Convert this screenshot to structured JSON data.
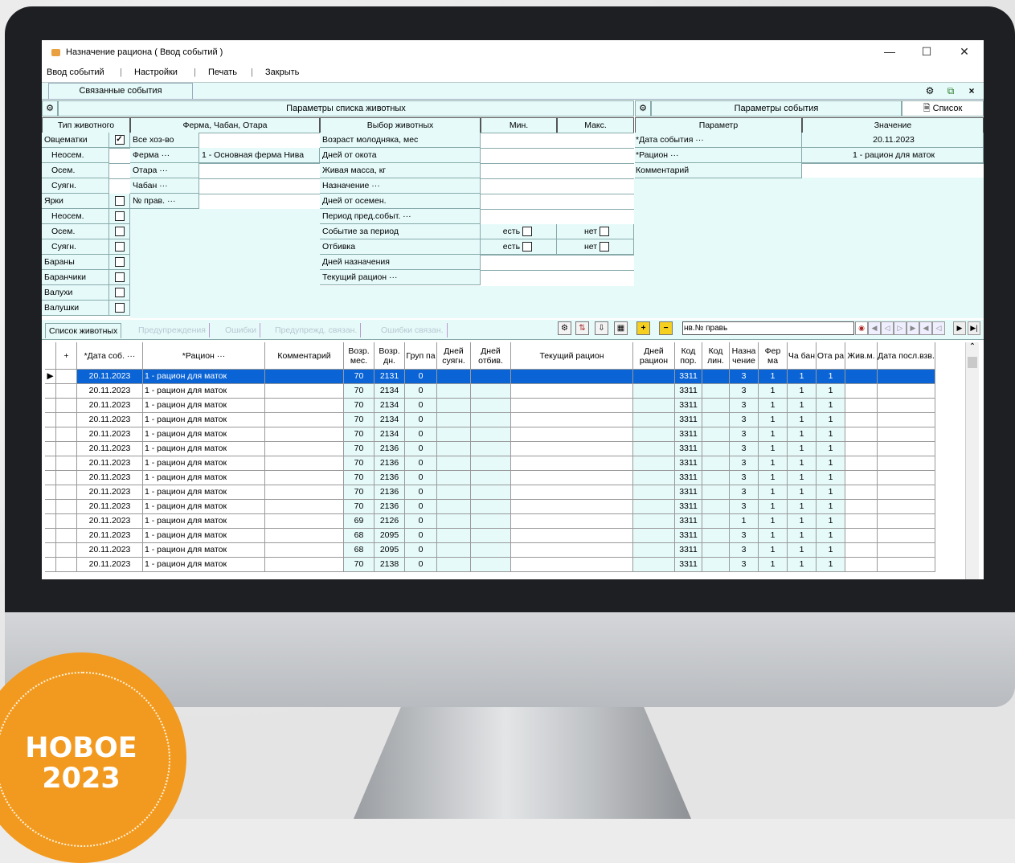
{
  "window": {
    "title": "Назначение рациона ( Ввод событий )"
  },
  "menu": [
    "Ввод событий",
    "Настройки",
    "Печать",
    "Закрыть"
  ],
  "linked_tab": "Связанные события",
  "animal_params": {
    "title": "Параметры списка животных",
    "type_header": "Тип животного",
    "farm_header": "Ферма, Чабан, Отара",
    "select_header": "Выбор животных",
    "min_header": "Мин.",
    "max_header": "Макс.",
    "types": [
      {
        "label": "Овцематки",
        "checked": true,
        "indent": false
      },
      {
        "label": "Неосем.",
        "checked": null,
        "indent": true
      },
      {
        "label": "Осем.",
        "checked": null,
        "indent": true
      },
      {
        "label": "Суягн.",
        "checked": null,
        "indent": true
      },
      {
        "label": "Ярки",
        "checked": false,
        "indent": false
      },
      {
        "label": "Неосем.",
        "checked": false,
        "indent": true
      },
      {
        "label": "Осем.",
        "checked": false,
        "indent": true
      },
      {
        "label": "Суягн.",
        "checked": false,
        "indent": true
      },
      {
        "label": "Бараны",
        "checked": false,
        "indent": false
      },
      {
        "label": "Баранчики",
        "checked": false,
        "indent": false
      },
      {
        "label": "Валухи",
        "checked": false,
        "indent": false
      },
      {
        "label": "Валушки",
        "checked": false,
        "indent": false
      }
    ],
    "farm_rows": [
      {
        "label": "Все хоз-во",
        "value": ""
      },
      {
        "label": "Ферма ···",
        "value": "1 - Основная ферма Нива"
      },
      {
        "label": "Отара ···",
        "value": ""
      },
      {
        "label": "Чабан ···",
        "value": ""
      },
      {
        "label": "№ прав. ···",
        "value": ""
      }
    ],
    "select_rows": [
      {
        "label": "Возраст молодняка, мес",
        "min": "",
        "max": ""
      },
      {
        "label": "Дней от окота",
        "min": "",
        "max": ""
      },
      {
        "label": "Живая масса, кг",
        "min": "",
        "max": ""
      },
      {
        "label": "Назначение ···",
        "min": "",
        "max": ""
      },
      {
        "label": "Дней от осемен.",
        "min": "",
        "max": ""
      },
      {
        "label": "Период пред.событ. ···",
        "min": "",
        "max": ""
      },
      {
        "label": "Событие за период",
        "min": "есть",
        "max": "нет"
      },
      {
        "label": "Отбивка",
        "min": "есть",
        "max": "нет"
      },
      {
        "label": "Дней назначения",
        "min": "",
        "max": ""
      },
      {
        "label": "Текущий рацион ···",
        "min": "",
        "max": ""
      }
    ]
  },
  "event_params": {
    "title": "Параметры события",
    "list_button": "Список",
    "param_header": "Параметр",
    "value_header": "Значение",
    "rows": [
      {
        "label": "*Дата события ···",
        "value": "20.11.2023"
      },
      {
        "label": "*Рацион ···",
        "value": "1 - рацион для маток"
      },
      {
        "label": "Комментарий",
        "value": ""
      }
    ]
  },
  "tabs": [
    "Список животных",
    "Предупреждения",
    "Ошибки",
    "Предупрежд. связан.",
    "Ошибки связан."
  ],
  "search_field": "нв.№ правь",
  "grid": {
    "headers": [
      "",
      "+",
      "*Дата соб. ···",
      "*Рацион ···",
      "Комментарий",
      "Возр. мес.",
      "Возр. дн.",
      "Груп па",
      "Дней суягн.",
      "Дней отбив.",
      "Текущий рацион",
      "Дней рацион",
      "Код пор.",
      "Код лин.",
      "Назна чение",
      "Фер ма",
      "Ча бан",
      "Ота ра",
      "Жив.м.",
      "Дата посл.взв."
    ],
    "rows": [
      [
        "20.11.2023",
        "1 - рацион для маток",
        "70",
        "2131",
        "0",
        "3311",
        "3",
        "1",
        "1",
        "1"
      ],
      [
        "20.11.2023",
        "1 - рацион для маток",
        "70",
        "2134",
        "0",
        "3311",
        "3",
        "1",
        "1",
        "1"
      ],
      [
        "20.11.2023",
        "1 - рацион для маток",
        "70",
        "2134",
        "0",
        "3311",
        "3",
        "1",
        "1",
        "1"
      ],
      [
        "20.11.2023",
        "1 - рацион для маток",
        "70",
        "2134",
        "0",
        "3311",
        "3",
        "1",
        "1",
        "1"
      ],
      [
        "20.11.2023",
        "1 - рацион для маток",
        "70",
        "2134",
        "0",
        "3311",
        "3",
        "1",
        "1",
        "1"
      ],
      [
        "20.11.2023",
        "1 - рацион для маток",
        "70",
        "2136",
        "0",
        "3311",
        "3",
        "1",
        "1",
        "1"
      ],
      [
        "20.11.2023",
        "1 - рацион для маток",
        "70",
        "2136",
        "0",
        "3311",
        "3",
        "1",
        "1",
        "1"
      ],
      [
        "20.11.2023",
        "1 - рацион для маток",
        "70",
        "2136",
        "0",
        "3311",
        "3",
        "1",
        "1",
        "1"
      ],
      [
        "20.11.2023",
        "1 - рацион для маток",
        "70",
        "2136",
        "0",
        "3311",
        "3",
        "1",
        "1",
        "1"
      ],
      [
        "20.11.2023",
        "1 - рацион для маток",
        "70",
        "2136",
        "0",
        "3311",
        "3",
        "1",
        "1",
        "1"
      ],
      [
        "20.11.2023",
        "1 - рацион для маток",
        "69",
        "2126",
        "0",
        "3311",
        "1",
        "1",
        "1",
        "1"
      ],
      [
        "20.11.2023",
        "1 - рацион для маток",
        "68",
        "2095",
        "0",
        "3311",
        "3",
        "1",
        "1",
        "1"
      ],
      [
        "20.11.2023",
        "1 - рацион для маток",
        "68",
        "2095",
        "0",
        "3311",
        "3",
        "1",
        "1",
        "1"
      ],
      [
        "20.11.2023",
        "1 - рацион для маток",
        "70",
        "2138",
        "0",
        "3311",
        "3",
        "1",
        "1",
        "1"
      ]
    ]
  },
  "badge": {
    "line1": "НОВОЕ",
    "line2": "2023"
  },
  "colors": {
    "selection": "#0a64d6",
    "panel": "#e6fafa",
    "badge": "#f29a1f"
  }
}
